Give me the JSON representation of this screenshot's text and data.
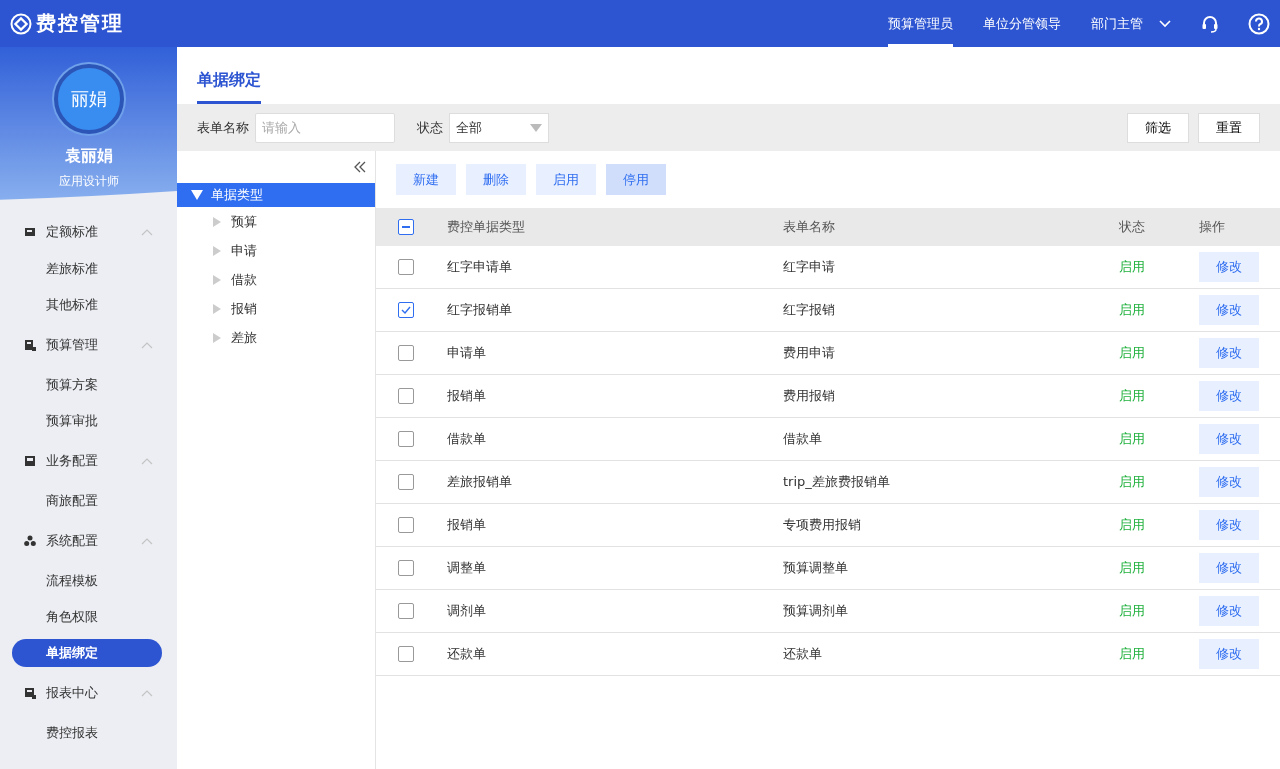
{
  "header": {
    "logo": "费控管理",
    "roles": [
      {
        "label": "预算管理员",
        "selected": true
      },
      {
        "label": "单位分管领导",
        "selected": false
      },
      {
        "label": "部门主管",
        "selected": false
      }
    ]
  },
  "user": {
    "avatar": "丽娟",
    "name": "袁丽娟",
    "title": "应用设计师"
  },
  "sidebar": {
    "groups": [
      {
        "label": "定额标准",
        "kind": "card",
        "expanded": true,
        "children": [
          {
            "label": "差旅标准",
            "selected": false
          },
          {
            "label": "其他标准",
            "selected": false
          }
        ]
      },
      {
        "label": "预算管理",
        "kind": "doc",
        "expanded": true,
        "children": [
          {
            "label": "预算方案",
            "selected": false
          },
          {
            "label": "预算审批",
            "selected": false
          }
        ]
      },
      {
        "label": "业务配置",
        "kind": "book",
        "expanded": true,
        "children": [
          {
            "label": "商旅配置",
            "selected": false
          }
        ]
      },
      {
        "label": "系统配置",
        "kind": "dots",
        "expanded": true,
        "children": [
          {
            "label": "流程模板",
            "selected": false
          },
          {
            "label": "角色权限",
            "selected": false
          },
          {
            "label": "单据绑定",
            "selected": true
          }
        ]
      },
      {
        "label": "报表中心",
        "kind": "report",
        "expanded": true,
        "children": [
          {
            "label": "费控报表",
            "selected": false
          }
        ]
      }
    ]
  },
  "page_title": "单据绑定",
  "filters": {
    "name_label": "表单名称",
    "name_placeholder": "请输入",
    "status_label": "状态",
    "status_value": "全部",
    "buttons": [
      "筛选",
      "重置"
    ]
  },
  "tree": {
    "label": "单据类型",
    "expanded": true,
    "selected": true,
    "children": [
      {
        "label": "预算"
      },
      {
        "label": "申请"
      },
      {
        "label": "借款"
      },
      {
        "label": "报销"
      },
      {
        "label": "差旅"
      }
    ]
  },
  "toolbar": [
    {
      "label": "新建",
      "hovered": false
    },
    {
      "label": "删除",
      "hovered": false
    },
    {
      "label": "启用",
      "hovered": false
    },
    {
      "label": "停用",
      "hovered": true
    }
  ],
  "table": {
    "columns": [
      "费控单据类型",
      "表单名称",
      "状态",
      "操作"
    ],
    "select_all_partial": true,
    "rows": [
      {
        "type": "红字申请单",
        "form": "红字申请",
        "status": "启用",
        "action": "修改",
        "checked": false
      },
      {
        "type": "红字报销单",
        "form": "红字报销",
        "status": "启用",
        "action": "修改",
        "checked": true
      },
      {
        "type": "申请单",
        "form": "费用申请",
        "status": "启用",
        "action": "修改",
        "checked": false
      },
      {
        "type": "报销单",
        "form": "费用报销",
        "status": "启用",
        "action": "修改",
        "checked": false
      },
      {
        "type": "借款单",
        "form": "借款单",
        "status": "启用",
        "action": "修改",
        "checked": false
      },
      {
        "type": "差旅报销单",
        "form": "trip_差旅费报销单",
        "status": "启用",
        "action": "修改",
        "checked": false
      },
      {
        "type": "报销单",
        "form": "专项费用报销",
        "status": "启用",
        "action": "修改",
        "checked": false
      },
      {
        "type": "调整单",
        "form": "预算调整单",
        "status": "启用",
        "action": "修改",
        "checked": false
      },
      {
        "type": "调剂单",
        "form": "预算调剂单",
        "status": "启用",
        "action": "修改",
        "checked": false
      },
      {
        "type": "还款单",
        "form": "还款单",
        "status": "启用",
        "action": "修改",
        "checked": false
      }
    ]
  }
}
